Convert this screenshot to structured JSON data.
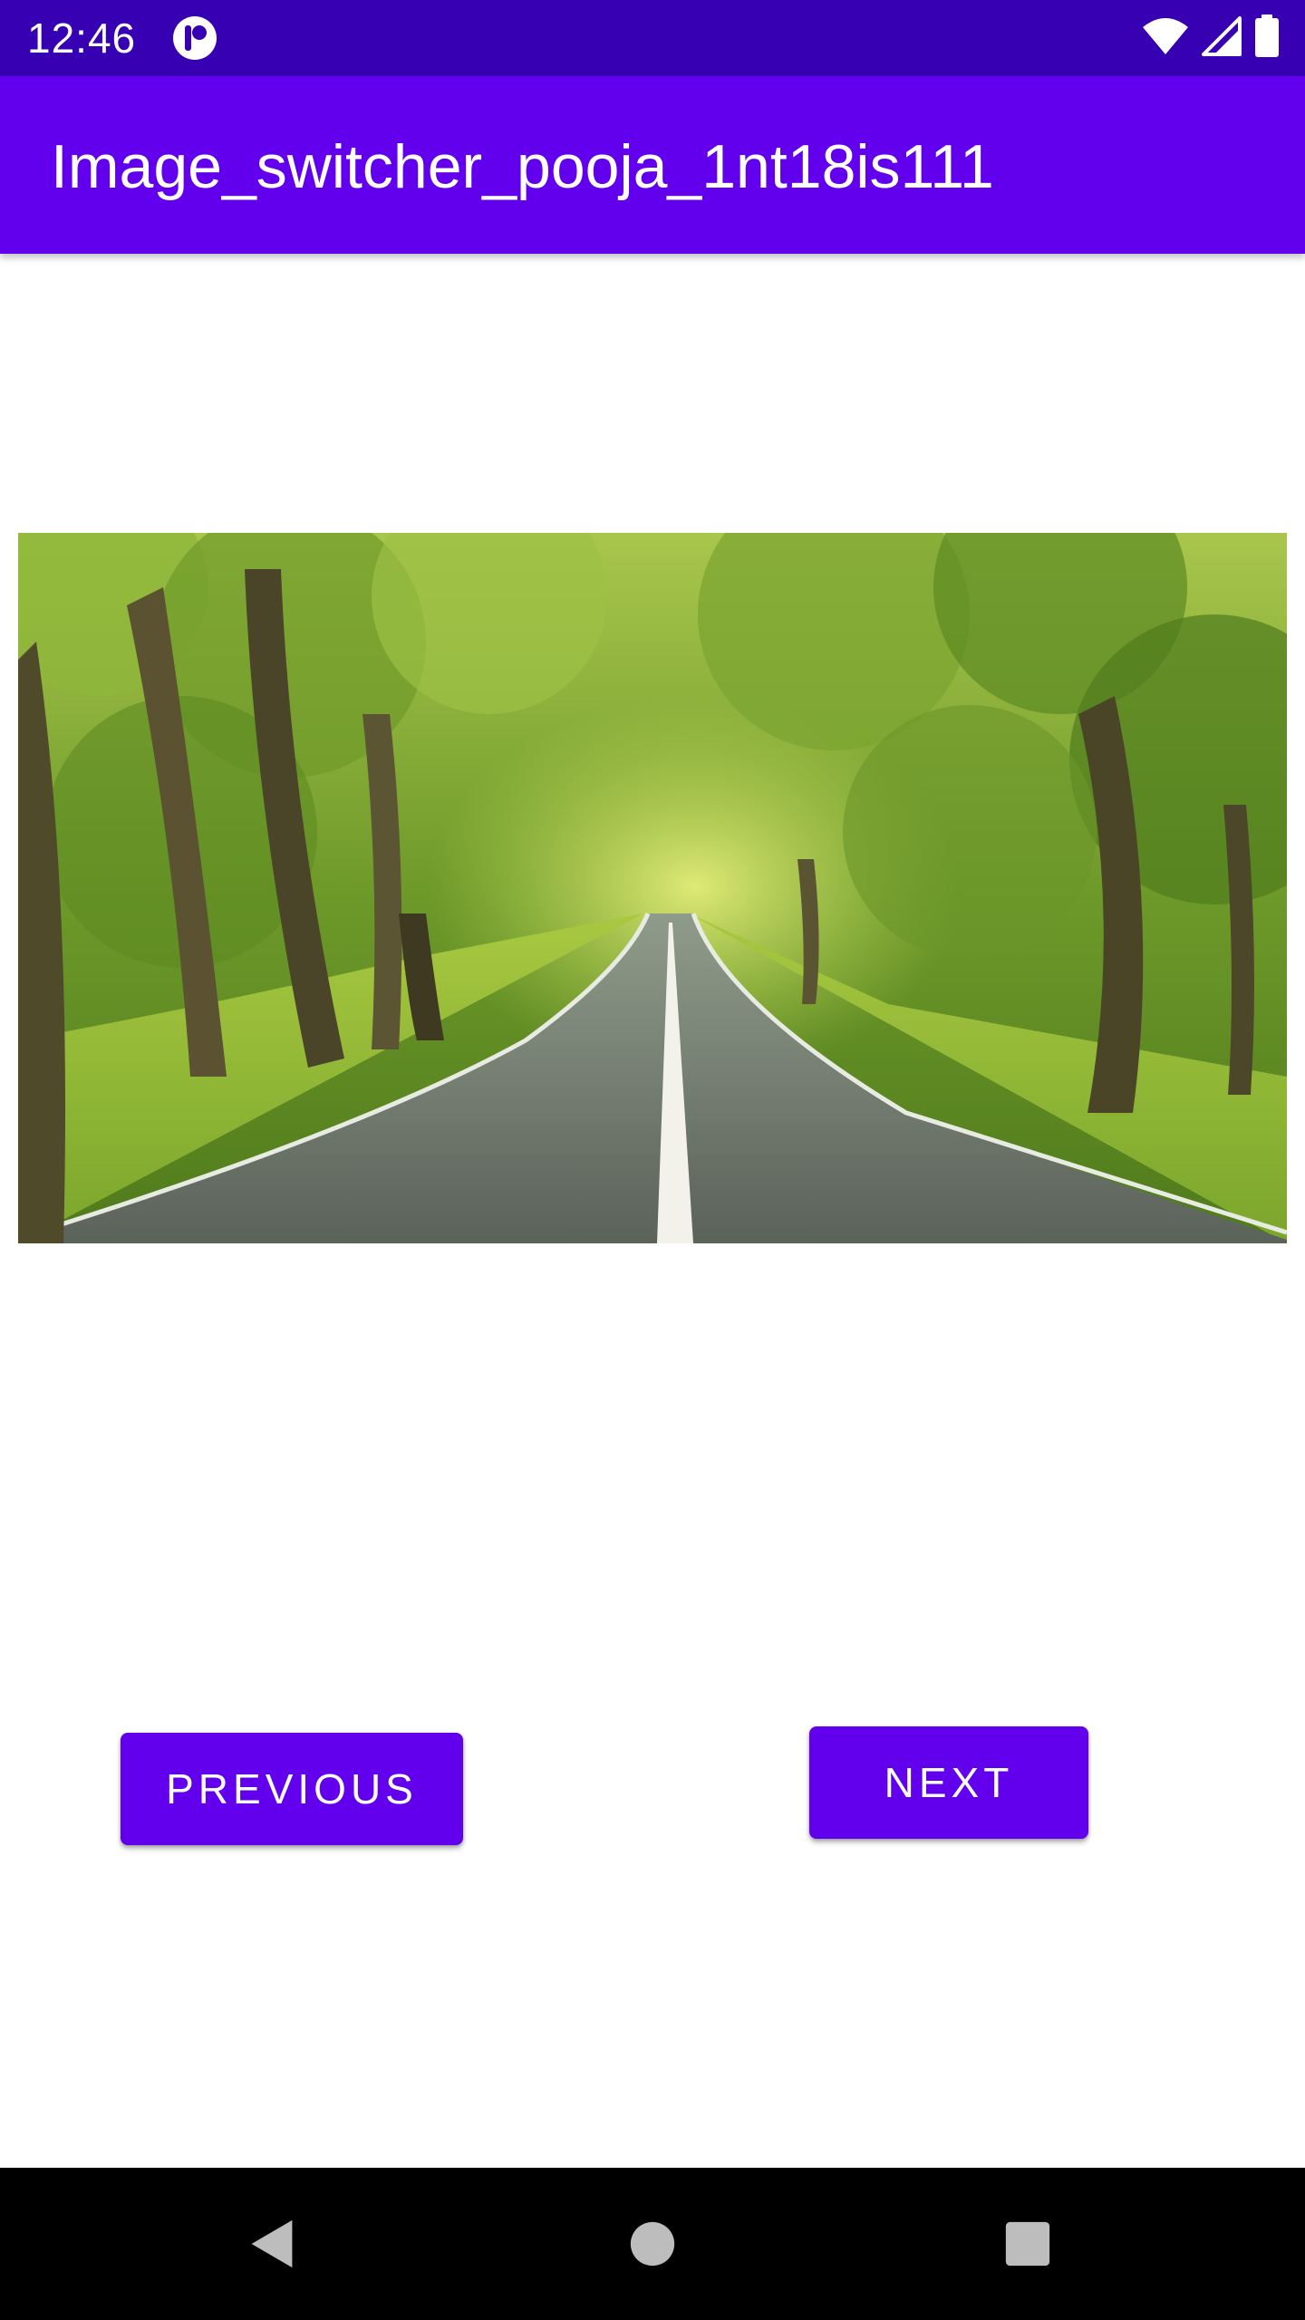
{
  "status_bar": {
    "time": "12:46",
    "icons": [
      "app-notification-icon",
      "wifi-icon",
      "cellular-signal-icon",
      "battery-icon"
    ]
  },
  "app_bar": {
    "title": "Image_switcher_pooja_1nt18is111"
  },
  "image_switcher": {
    "image": "tree-lined-road-photo"
  },
  "buttons": {
    "previous_label": "PREVIOUS",
    "next_label": "NEXT"
  },
  "nav_bar": {
    "icons": [
      "back-icon",
      "home-icon",
      "recents-icon"
    ]
  },
  "colors": {
    "status_bar": "#3700B3",
    "primary": "#6200EE",
    "on_primary": "#FFFFFF",
    "nav_bar": "#000000"
  }
}
